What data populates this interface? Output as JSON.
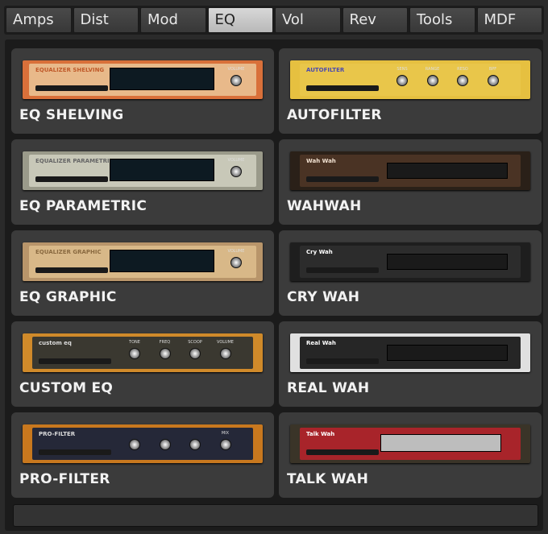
{
  "tabs": [
    {
      "label": "Amps"
    },
    {
      "label": "Dist"
    },
    {
      "label": "Mod"
    },
    {
      "label": "EQ",
      "active": true
    },
    {
      "label": "Vol"
    },
    {
      "label": "Rev"
    },
    {
      "label": "Tools"
    },
    {
      "label": "MDF"
    }
  ],
  "modules": [
    {
      "label": "EQ SHELVING",
      "thumb_title": "EQUALIZER SHELVING",
      "frame": "#d9703a",
      "panel": "#e8b98a",
      "title_color": "#c05a2a",
      "style": "eq",
      "knobs": [
        "VOLUME"
      ]
    },
    {
      "label": "AUTOFILTER",
      "thumb_title": "AUTOFILTER",
      "frame": "#e6c040",
      "panel": "#e9c64a",
      "title_color": "#4a4ab0",
      "style": "knobs",
      "knobs": [
        "SENS",
        "RANGE",
        "RESO",
        "BPF"
      ]
    },
    {
      "label": "EQ PARAMETRIC",
      "thumb_title": "EQUALIZER PARAMETRIC",
      "frame": "#9a9a8a",
      "panel": "#c8c8b8",
      "title_color": "#666",
      "style": "eq",
      "knobs": [
        "VOLUME"
      ]
    },
    {
      "label": "WAHWAH",
      "thumb_title": "Wah Wah",
      "frame": "#2a2018",
      "panel": "#4a3324",
      "title_color": "#f0e0d0",
      "style": "wah",
      "knobs": []
    },
    {
      "label": "EQ GRAPHIC",
      "thumb_title": "EQUALIZER GRAPHIC",
      "frame": "#b8956a",
      "panel": "#d8b888",
      "title_color": "#8a6a40",
      "style": "eq",
      "knobs": [
        "VOLUME"
      ]
    },
    {
      "label": "CRY WAH",
      "thumb_title": "Cry Wah",
      "frame": "#1e1e1e",
      "panel": "#2c2c2c",
      "title_color": "#fff",
      "style": "wah",
      "knobs": []
    },
    {
      "label": "CUSTOM EQ",
      "thumb_title": "custom eq",
      "frame": "#d08a2a",
      "panel": "#3a3830",
      "title_color": "#ddd",
      "style": "knobs",
      "knobs": [
        "TONE",
        "FREQ",
        "SCOOP",
        "VOLUME"
      ]
    },
    {
      "label": "REAL WAH",
      "thumb_title": "Real Wah",
      "frame": "#e0e0e0",
      "panel": "#262626",
      "title_color": "#fff",
      "style": "wah",
      "knobs": []
    },
    {
      "label": "PRO-FILTER",
      "thumb_title": "PRO-FILTER",
      "frame": "#c8781e",
      "panel": "#252838",
      "title_color": "#ddd",
      "style": "knobs",
      "knobs": [
        "",
        "",
        "",
        "MIX"
      ]
    },
    {
      "label": "TALK WAH",
      "thumb_title": "Talk Wah",
      "frame": "#3a3428",
      "panel": "#a8242a",
      "title_color": "#fff",
      "style": "talk",
      "knobs": []
    }
  ]
}
